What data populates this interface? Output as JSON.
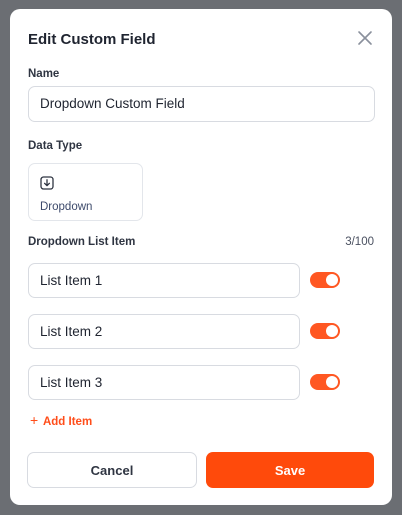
{
  "modal": {
    "title": "Edit Custom Field",
    "name_label": "Name",
    "name_value": "Dropdown Custom Field",
    "data_type_label": "Data Type",
    "data_type": {
      "label": "Dropdown",
      "icon": "dropdown-arrow-icon"
    },
    "list_label": "Dropdown List Item",
    "list_count": "3/100",
    "items": [
      {
        "label": "List Item 1",
        "enabled": true
      },
      {
        "label": "List Item 2",
        "enabled": true
      },
      {
        "label": "List Item 3",
        "enabled": true
      }
    ],
    "add_item_label": "Add Item",
    "cancel_label": "Cancel",
    "save_label": "Save"
  },
  "colors": {
    "accent": "#ff4a0b",
    "toggle_on": "#ff5722"
  }
}
